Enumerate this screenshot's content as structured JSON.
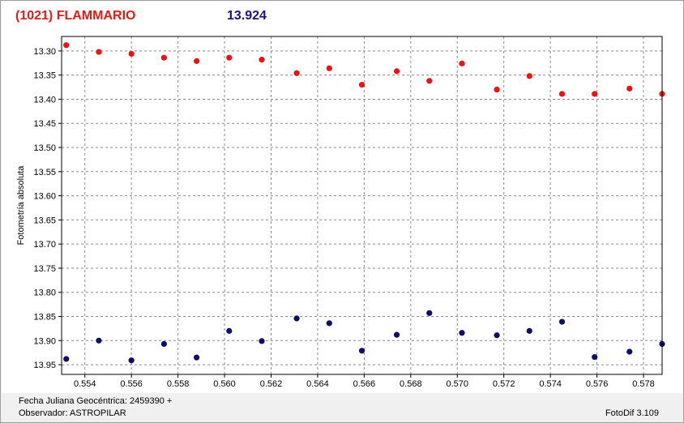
{
  "header": {
    "object_name": "(1021) FLAMMARIO",
    "magnitude": "13.924"
  },
  "footer": {
    "jd_label": "Fecha Juliana Geocéntrica:",
    "jd_value": "2459390 +",
    "observer_label": "Observador:",
    "observer_value": "ASTROPILAR",
    "version": "FotoDif 3.109"
  },
  "colors": {
    "target_series": "#ee1111",
    "comparison_series": "#0d0d6b",
    "object_title": "#e41b17",
    "magnitude_title": "#16167a"
  },
  "chart_data": {
    "type": "scatter",
    "ylabel": "Fotometría absoluta",
    "xlabel": "",
    "xlim": [
      0.553,
      0.5788
    ],
    "ylim": [
      13.27,
      13.97
    ],
    "y_inverted": true,
    "grid": true,
    "x_ticks": [
      "0.554",
      "0.556",
      "0.558",
      "0.560",
      "0.562",
      "0.564",
      "0.566",
      "0.568",
      "0.570",
      "0.572",
      "0.574",
      "0.576",
      "0.578"
    ],
    "y_ticks": [
      "13.30",
      "13.35",
      "13.40",
      "13.45",
      "13.50",
      "13.55",
      "13.60",
      "13.65",
      "13.70",
      "13.75",
      "13.80",
      "13.85",
      "13.90",
      "13.95"
    ],
    "series": [
      {
        "x": [
          0.5532,
          0.5546,
          0.556,
          0.5574,
          0.5588,
          0.5602,
          0.5616,
          0.5631,
          0.5645,
          0.5659,
          0.5674,
          0.5688,
          0.5702,
          0.5717,
          0.5731,
          0.5745,
          0.5759,
          0.5774,
          0.5788
        ],
        "y": [
          13.288,
          13.302,
          13.306,
          13.314,
          13.321,
          13.314,
          13.318,
          13.346,
          13.336,
          13.37,
          13.342,
          13.362,
          13.326,
          13.38,
          13.352,
          13.389,
          13.389,
          13.378,
          13.389
        ]
      },
      {
        "x": [
          0.5532,
          0.5546,
          0.556,
          0.5574,
          0.5588,
          0.5602,
          0.5616,
          0.5631,
          0.5645,
          0.5659,
          0.5674,
          0.5688,
          0.5702,
          0.5717,
          0.5731,
          0.5745,
          0.5759,
          0.5774,
          0.5788
        ],
        "y": [
          13.938,
          13.9,
          13.941,
          13.907,
          13.935,
          13.88,
          13.901,
          13.854,
          13.864,
          13.921,
          13.888,
          13.843,
          13.884,
          13.889,
          13.88,
          13.861,
          13.934,
          13.923,
          13.907
        ]
      }
    ]
  }
}
